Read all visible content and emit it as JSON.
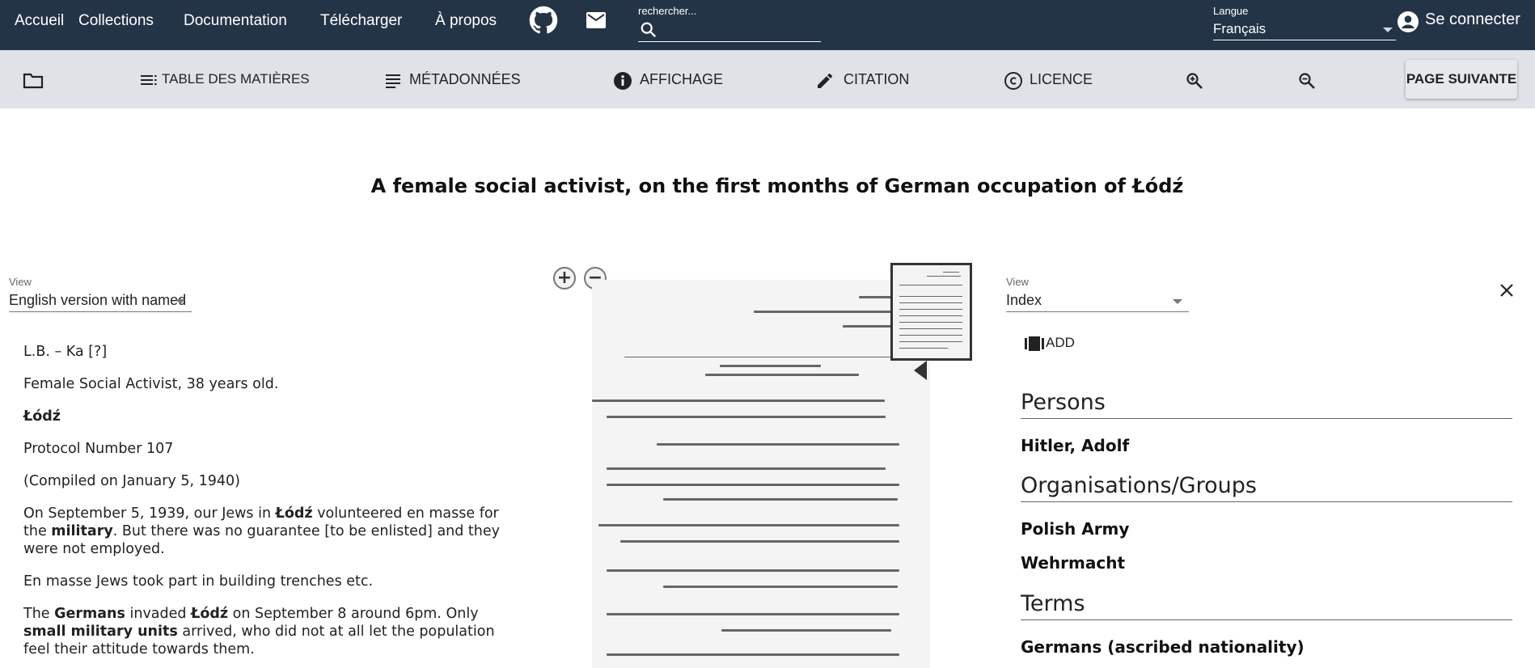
{
  "nav": {
    "items": [
      "Accueil",
      "Collections",
      "Documentation",
      "Télécharger",
      "À propos"
    ],
    "search_label": "rechercher...",
    "language_label": "Langue",
    "language_value": "Français",
    "login_label": "Se connecter"
  },
  "toolbar": {
    "toc_label": "TABLE DES MATIÈRES",
    "metadata_label": "MÉTADONNÉES",
    "display_label": "AFFICHAGE",
    "citation_label": "CITATION",
    "license_label": "LICENCE",
    "next_page_label": "PAGE SUIVANTE"
  },
  "document": {
    "title": "A female social activist, on the first months of German occupation of Łódź"
  },
  "left_panel": {
    "view_label": "View",
    "view_value": "English version with named",
    "paragraphs": [
      "L.B. – Ka [?]",
      "Female Social Activist, 38 years old.",
      "Łódź",
      "Protocol Number 107",
      "(Compiled on January 5, 1940)"
    ],
    "p6": {
      "a": "On September 5, 1939, our Jews in ",
      "b": "Łódź",
      "c": " volunteered en masse for the ",
      "d": "military",
      "e": ". But there was no guarantee [to be enlisted] and they were not employed."
    },
    "p7": "En masse Jews took part in building trenches etc.",
    "p8": {
      "a": "The ",
      "b": "Germans",
      "c": " invaded ",
      "d": "Łódź",
      "e": " on September 8 around 6pm. Only ",
      "f": "small military units",
      "g": " arrived, who did not at all let the population feel their attitude towards them."
    }
  },
  "right_panel": {
    "view_label": "View",
    "view_value": "Index",
    "add_label": "ADD",
    "sections": [
      {
        "title": "Persons",
        "entries": [
          "Hitler, Adolf"
        ]
      },
      {
        "title": "Organisations/Groups",
        "entries": [
          "Polish Army",
          "Wehrmacht"
        ]
      },
      {
        "title": "Terms",
        "entries": [
          "Germans (ascribed nationality)"
        ]
      }
    ]
  },
  "colors": {
    "topbar": "#243447",
    "toolbar": "#dfe3e8",
    "text": "#222222"
  },
  "icons": [
    "github-icon",
    "mail-icon",
    "search-icon",
    "account-icon",
    "folder-icon",
    "toc-icon",
    "metadata-icon",
    "info-icon",
    "pencil-icon",
    "copyright-icon",
    "zoom-in-icon",
    "zoom-out-icon",
    "close-icon",
    "add-icon"
  ]
}
